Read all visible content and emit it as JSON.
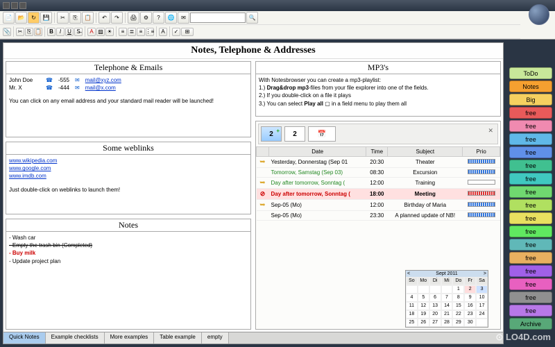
{
  "page_title": "Notes, Telephone & Addresses",
  "panels": {
    "telephone": {
      "header": "Telephone & Emails",
      "rows": [
        {
          "name": "John Doe",
          "phone": "-555",
          "email": "mail@xyz.com"
        },
        {
          "name": "Mr. X",
          "phone": "-444",
          "email": "mail@x.com"
        }
      ],
      "note": "You can click on any email address and your standard mail reader will be launched!"
    },
    "mp3": {
      "header": "MP3's",
      "intro": "With Notesbrowser you can create a mp3-playlist:",
      "line1": "1.) Drag&drop mp3-files from your file explorer into one of the fields.",
      "line2": "2.) If you double-click on a file it plays",
      "line3": "3.) You can select Play all ▢ in a field menu to play them all"
    },
    "weblinks": {
      "header": "Some weblinks",
      "links": [
        "www.wikipedia.com",
        "www.google.com",
        "www.imdb.com"
      ],
      "note": "Just double-click on weblinks to launch them!"
    },
    "notes": {
      "header": "Notes",
      "items": [
        {
          "text": "- Wash car",
          "style": ""
        },
        {
          "text": "- Empty the trash bin (Completed)",
          "style": "strike"
        },
        {
          "text": "- Buy milk",
          "style": "red"
        },
        {
          "text": "- Update project plan",
          "style": ""
        }
      ]
    }
  },
  "appointments": {
    "tab_label": "2",
    "columns": {
      "date": "Date",
      "time": "Time",
      "subject": "Subject",
      "prio": "Prio"
    },
    "rows": [
      {
        "icon": "arrow",
        "date": "Yesterday, Donnerstag (Sep 01",
        "time": "20:30",
        "subject": "Theater",
        "prio": "blue",
        "cls": ""
      },
      {
        "icon": "",
        "date": "Tomorrow, Samstag (Sep 03)",
        "time": "08:30",
        "subject": "Excursion",
        "prio": "blue",
        "cls": "green"
      },
      {
        "icon": "arrow",
        "date": "Day after tomorrow, Sonntag (",
        "time": "12:00",
        "subject": "Training",
        "prio": "empty",
        "cls": "green"
      },
      {
        "icon": "warn",
        "date": "Day after tomorrow, Sonntag (",
        "time": "18:00",
        "subject": "Meeting",
        "prio": "red",
        "cls": "pink red"
      },
      {
        "icon": "arrow",
        "date": "Sep-05 (Mo)",
        "time": "12:00",
        "subject": "Birthday of Maria",
        "prio": "blue",
        "cls": ""
      },
      {
        "icon": "",
        "date": "Sep-05 (Mo)",
        "time": "23:30",
        "subject": "A planned update of NB!",
        "prio": "blue",
        "cls": ""
      }
    ]
  },
  "calendar": {
    "month": "Sept 2011",
    "dow": [
      "So",
      "Mo",
      "Di",
      "Mi",
      "Do",
      "Fr",
      "Sa"
    ],
    "days": [
      [
        "",
        "",
        "",
        "",
        "1",
        "2",
        "3"
      ],
      [
        "4",
        "5",
        "6",
        "7",
        "8",
        "9",
        "10"
      ],
      [
        "11",
        "12",
        "13",
        "14",
        "15",
        "16",
        "17"
      ],
      [
        "18",
        "19",
        "20",
        "21",
        "22",
        "23",
        "24"
      ],
      [
        "25",
        "26",
        "27",
        "28",
        "29",
        "30",
        ""
      ]
    ],
    "today": "2",
    "sel": "3"
  },
  "bottom_tabs": [
    "Quick Notes",
    "Example checklists",
    "More examples",
    "Table example",
    "empty"
  ],
  "side_tabs": [
    {
      "label": "ToDo",
      "color": "#c8e89a"
    },
    {
      "label": "Notes",
      "color": "#f5a030"
    },
    {
      "label": "Big",
      "color": "#f5d060"
    },
    {
      "label": "free",
      "color": "#e85a5a"
    },
    {
      "label": "free",
      "color": "#f08ab0"
    },
    {
      "label": "free",
      "color": "#60b8e8"
    },
    {
      "label": "free",
      "color": "#6090e8"
    },
    {
      "label": "free",
      "color": "#40c090"
    },
    {
      "label": "free",
      "color": "#40c8c0"
    },
    {
      "label": "free",
      "color": "#70d870"
    },
    {
      "label": "free",
      "color": "#b0e060"
    },
    {
      "label": "free",
      "color": "#e8e060"
    },
    {
      "label": "free",
      "color": "#60e860"
    },
    {
      "label": "free",
      "color": "#60b8b8"
    },
    {
      "label": "free",
      "color": "#e8b060"
    },
    {
      "label": "free",
      "color": "#a060e8"
    },
    {
      "label": "free",
      "color": "#e860c0"
    },
    {
      "label": "free",
      "color": "#909090"
    },
    {
      "label": "free",
      "color": "#b878e8"
    },
    {
      "label": "Archive",
      "color": "#58a878"
    }
  ],
  "watermark": "⊙ LO4D.com"
}
